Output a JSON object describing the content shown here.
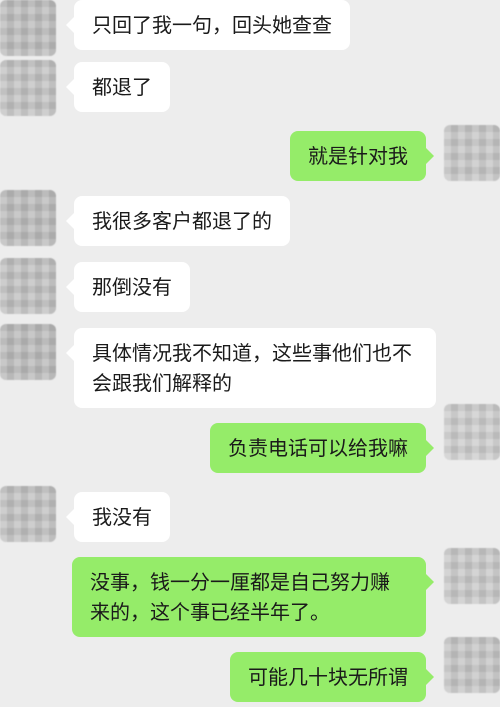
{
  "conversation": {
    "messages": [
      {
        "side": "left",
        "text": "只回了我一句，回头她查查"
      },
      {
        "side": "left",
        "text": "都退了"
      },
      {
        "side": "right",
        "text": "就是针对我"
      },
      {
        "side": "left",
        "text": "我很多客户都退了的"
      },
      {
        "side": "left",
        "text": "那倒没有"
      },
      {
        "side": "left",
        "text": "具体情况我不知道，这些事他们也不会跟我们解释的"
      },
      {
        "side": "right",
        "text": "负责电话可以给我嘛"
      },
      {
        "side": "left",
        "text": "我没有"
      },
      {
        "side": "right",
        "text": "没事，钱一分一厘都是自己努力赚来的，这个事已经半年了。"
      },
      {
        "side": "right",
        "text": "可能几十块无所谓"
      }
    ]
  },
  "colors": {
    "background": "#ededed",
    "incoming_bubble": "#ffffff",
    "outgoing_bubble": "#95ec69",
    "text": "#1a1a1a"
  }
}
